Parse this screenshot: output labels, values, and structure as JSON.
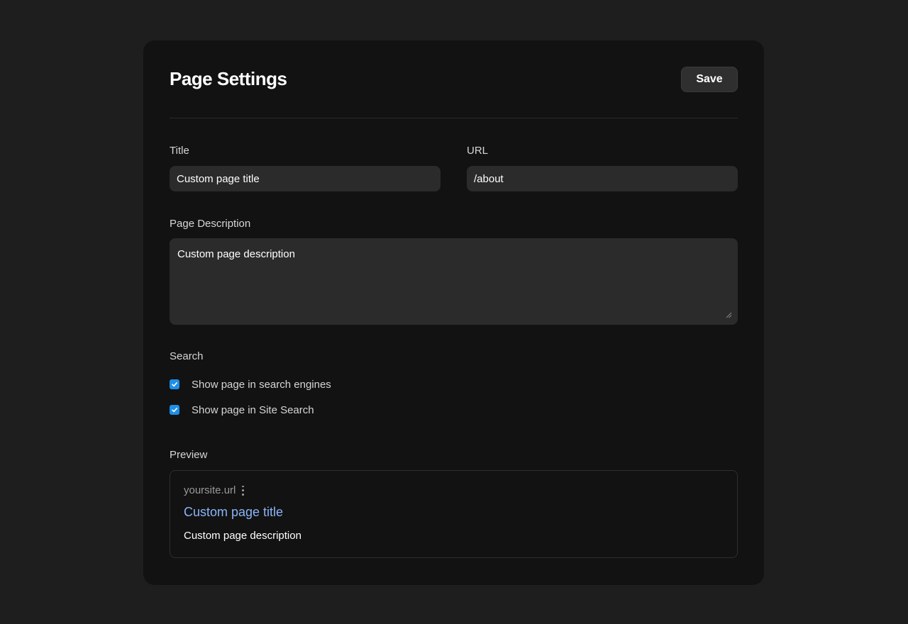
{
  "header": {
    "title": "Page Settings",
    "save_label": "Save"
  },
  "form": {
    "title_label": "Title",
    "title_value": "Custom page title",
    "url_label": "URL",
    "url_value": "/about",
    "description_label": "Page Description",
    "description_value": "Custom page description"
  },
  "search": {
    "label": "Search",
    "options": [
      {
        "label": "Show page in search engines",
        "checked": true
      },
      {
        "label": "Show page in Site Search",
        "checked": true
      }
    ]
  },
  "preview": {
    "label": "Preview",
    "site_url": "yoursite.url",
    "title": "Custom page title",
    "description": "Custom page description"
  },
  "colors": {
    "background": "#1e1e1e",
    "card": "#121212",
    "input": "#2b2b2b",
    "checkbox": "#1e8fe8",
    "preview_title": "#8ab4f8"
  }
}
